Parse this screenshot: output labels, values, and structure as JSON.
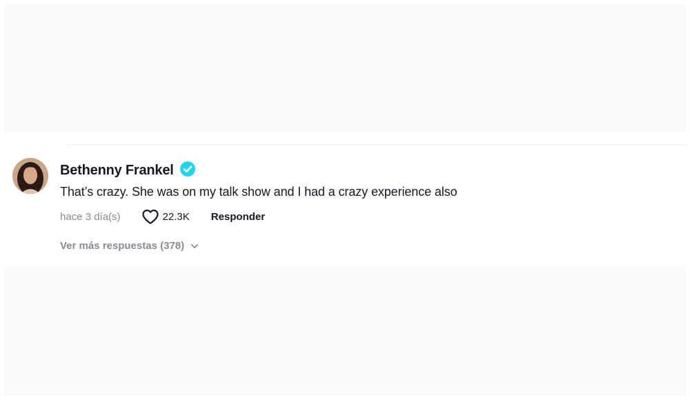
{
  "comment": {
    "author": "Bethenny Frankel",
    "verified": true,
    "text": "That’s crazy. She was on my talk show and I had a crazy experience also",
    "timestamp": "hace 3 día(s)",
    "likes": "22.3K",
    "reply_label": "Responder",
    "more_replies_label": "Ver más respuestas (378)"
  },
  "icons": {
    "avatar": "profile-photo",
    "verified": "verified-check-icon",
    "like": "heart-outline-icon",
    "more": "chevron-down-icon"
  },
  "colors": {
    "verified_badge": "#20d5ec",
    "text_primary": "#161823",
    "text_secondary": "#8a8b91"
  }
}
